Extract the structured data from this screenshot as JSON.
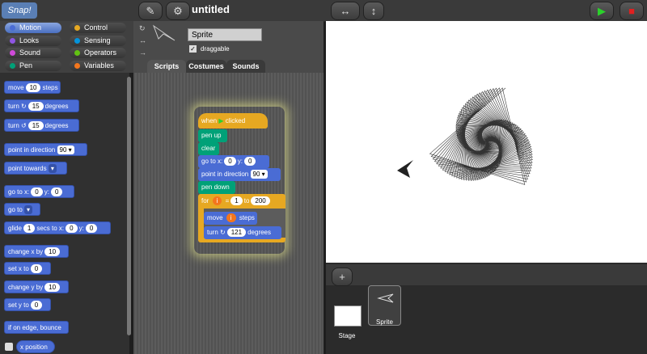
{
  "app": {
    "logo": "Snap!",
    "title": "untitled"
  },
  "toolbar": {
    "file_icon": "pencil-icon",
    "settings_icon": "gear-icon",
    "stage_size": "↔",
    "stage_swap": "↕",
    "go": "▶",
    "stop": "■"
  },
  "categories": [
    {
      "label": "Motion",
      "color": "#4a6cd4"
    },
    {
      "label": "Control",
      "color": "#e6a822"
    },
    {
      "label": "Looks",
      "color": "#8f56e3"
    },
    {
      "label": "Sensing",
      "color": "#0494dc"
    },
    {
      "label": "Sound",
      "color": "#cf4ad9"
    },
    {
      "label": "Operators",
      "color": "#62c213"
    },
    {
      "label": "Pen",
      "color": "#00a178"
    },
    {
      "label": "Variables",
      "color": "#f3761d"
    }
  ],
  "palette": {
    "move_pre": "move",
    "move_val": "10",
    "move_post": "steps",
    "turn_r_pre": "turn",
    "turn_r_icon": "↻",
    "turn_r_val": "15",
    "turn_r_post": "degrees",
    "turn_l_pre": "turn",
    "turn_l_icon": "↺",
    "turn_l_val": "15",
    "turn_l_post": "degrees",
    "point_dir": "point in direction",
    "point_dir_val": "90 ▾",
    "point_towards": "point towards",
    "point_towards_val": "▾",
    "goto_xy_pre": "go to x:",
    "goto_x": "0",
    "goto_y_label": "y:",
    "goto_y": "0",
    "goto": "go to",
    "goto_val": "▾",
    "glide_pre": "glide",
    "glide_val": "1",
    "glide_mid": "secs to x:",
    "glide_x": "0",
    "glide_y_label": "y:",
    "glide_y": "0",
    "change_x": "change x by",
    "change_x_val": "10",
    "set_x": "set x to",
    "set_x_val": "0",
    "change_y": "change y by",
    "change_y_val": "10",
    "set_y": "set y to",
    "set_y_val": "0",
    "bounce": "if on edge, bounce",
    "x_position": "x position"
  },
  "sprite": {
    "name": "Sprite",
    "draggable": "draggable",
    "check": "✓"
  },
  "tabs": [
    "Scripts",
    "Costumes",
    "Sounds"
  ],
  "script": {
    "hat": "when",
    "hat_icon": "▶",
    "hat_post": "clicked",
    "pen_up": "pen up",
    "clear": "clear",
    "goto_pre": "go to x:",
    "goto_x": "0",
    "goto_y_label": "y:",
    "goto_y": "0",
    "point": "point in direction",
    "point_val": "90 ▾",
    "pen_down": "pen down",
    "for_pre": "for",
    "for_var": "i",
    "for_eq": "=",
    "for_from": "1",
    "for_to_label": "to",
    "for_to": "200",
    "move_pre": "move",
    "move_var": "i",
    "move_post": "steps",
    "turn_pre": "turn",
    "turn_icon": "↻",
    "turn_val": "121",
    "turn_post": "degrees"
  },
  "corral": {
    "add": "+",
    "stage_label": "Stage",
    "sprite_label": "Sprite"
  }
}
